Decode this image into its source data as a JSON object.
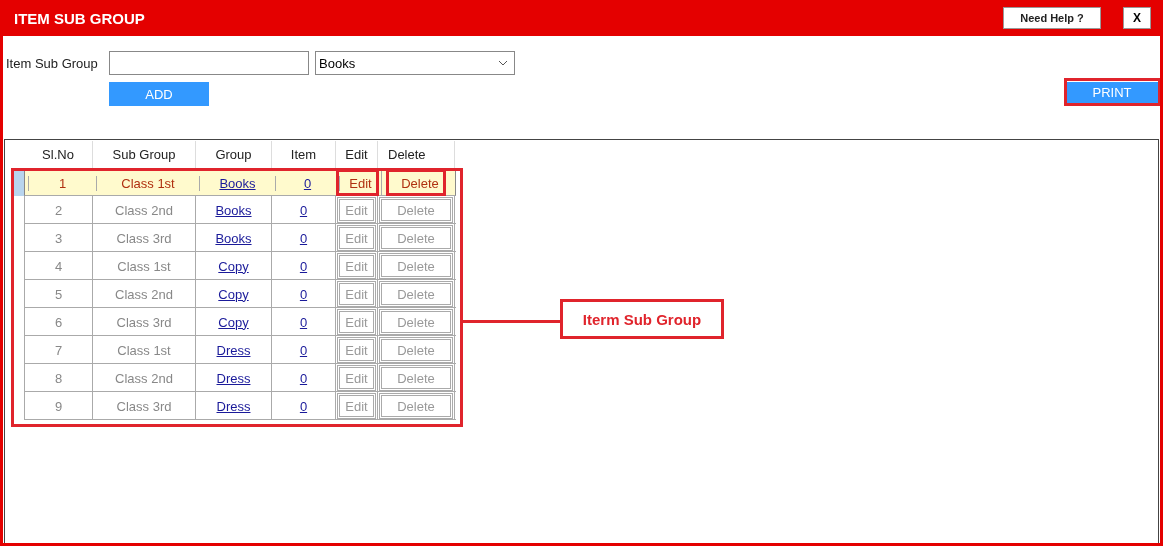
{
  "window": {
    "title": "ITEM SUB GROUP",
    "help_button": "Need Help ?",
    "close_button": "X"
  },
  "form": {
    "label": "Item Sub Group",
    "group_select": {
      "value": "Books"
    },
    "add_button": "ADD",
    "print_button": "PRINT"
  },
  "table": {
    "columns": [
      "Sl.No",
      "Sub Group",
      "Group",
      "Item",
      "Edit",
      "Delete"
    ],
    "rows": [
      {
        "sl_no": "1",
        "sub_group": "Class 1st",
        "group": "Books",
        "item": "0",
        "edit": "Edit",
        "delete": "Delete",
        "selected": true
      },
      {
        "sl_no": "2",
        "sub_group": "Class 2nd",
        "group": "Books",
        "item": "0",
        "edit": "Edit",
        "delete": "Delete",
        "selected": false
      },
      {
        "sl_no": "3",
        "sub_group": "Class 3rd",
        "group": "Books",
        "item": "0",
        "edit": "Edit",
        "delete": "Delete",
        "selected": false
      },
      {
        "sl_no": "4",
        "sub_group": "Class 1st",
        "group": "Copy",
        "item": "0",
        "edit": "Edit",
        "delete": "Delete",
        "selected": false
      },
      {
        "sl_no": "5",
        "sub_group": "Class 2nd",
        "group": "Copy",
        "item": "0",
        "edit": "Edit",
        "delete": "Delete",
        "selected": false
      },
      {
        "sl_no": "6",
        "sub_group": "Class 3rd",
        "group": "Copy",
        "item": "0",
        "edit": "Edit",
        "delete": "Delete",
        "selected": false
      },
      {
        "sl_no": "7",
        "sub_group": "Class 1st",
        "group": "Dress",
        "item": "0",
        "edit": "Edit",
        "delete": "Delete",
        "selected": false
      },
      {
        "sl_no": "8",
        "sub_group": "Class 2nd",
        "group": "Dress",
        "item": "0",
        "edit": "Edit",
        "delete": "Delete",
        "selected": false
      },
      {
        "sl_no": "9",
        "sub_group": "Class 3rd",
        "group": "Dress",
        "item": "0",
        "edit": "Edit",
        "delete": "Delete",
        "selected": false
      }
    ]
  },
  "callout": {
    "label": "Iterm Sub Group"
  }
}
